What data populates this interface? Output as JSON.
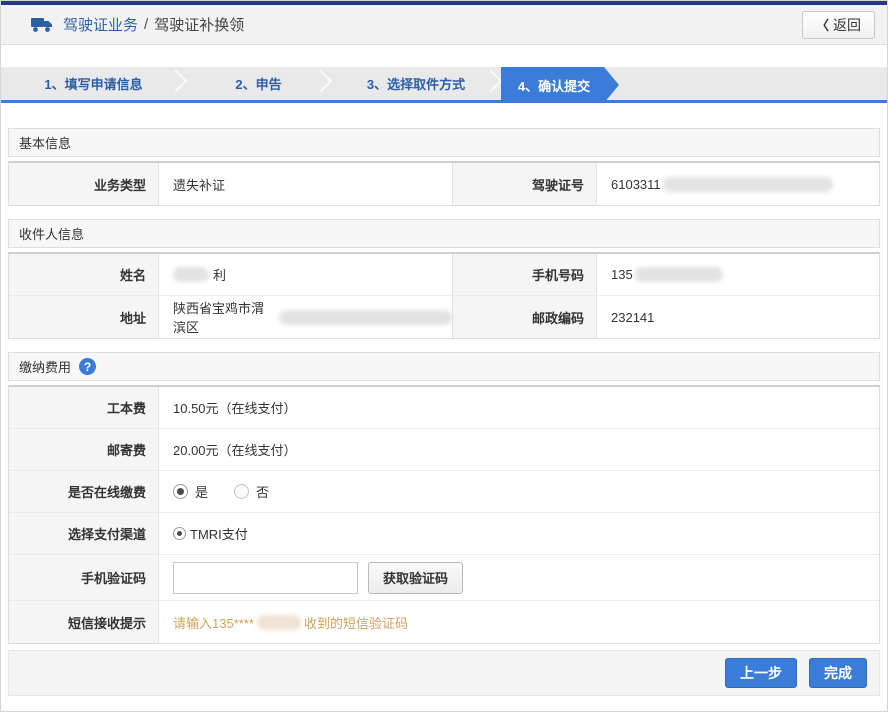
{
  "header": {
    "title_primary": "驾驶证业务",
    "separator": "/",
    "title_secondary": "驾驶证补换领",
    "back_chevron": "〈",
    "back_label": "返回"
  },
  "steps": [
    {
      "label": "1、填写申请信息",
      "active": false
    },
    {
      "label": "2、申告",
      "active": false
    },
    {
      "label": "3、选择取件方式",
      "active": false
    },
    {
      "label": "4、确认提交",
      "active": true
    }
  ],
  "basic_info": {
    "title": "基本信息",
    "business_type_label": "业务类型",
    "business_type_value": "遗失补证",
    "license_label": "驾驶证号",
    "license_value_visible": "6103311"
  },
  "recipient": {
    "title": "收件人信息",
    "name_label": "姓名",
    "name_value_suffix": "利",
    "phone_label": "手机号码",
    "phone_value_visible": "135",
    "address_label": "地址",
    "address_value_visible": "陕西省宝鸡市渭滨区",
    "postcode_label": "邮政编码",
    "postcode_value": "232141"
  },
  "fees": {
    "title": "缴纳费用",
    "help_icon": "?",
    "production_fee_label": "工本费",
    "production_fee_value": "10.50元（在线支付）",
    "postage_fee_label": "邮寄费",
    "postage_fee_value": "20.00元（在线支付）",
    "online_pay_label": "是否在线缴费",
    "online_pay_yes": "是",
    "online_pay_no": "否",
    "online_pay_selected": "是",
    "channel_label": "选择支付渠道",
    "channel_option": "TMRI支付",
    "sms_code_label": "手机验证码",
    "sms_code_input_value": "",
    "sms_code_button": "获取验证码",
    "sms_hint_label": "短信接收提示",
    "sms_hint_prefix": "请输入135****",
    "sms_hint_suffix": "收到的短信验证码"
  },
  "footer": {
    "prev_label": "上一步",
    "finish_label": "完成"
  },
  "colors": {
    "navy": "#223a8c",
    "primary_blue": "#3b7cd9",
    "link_blue": "#2c5faa",
    "hint_orange": "#cfa258"
  }
}
